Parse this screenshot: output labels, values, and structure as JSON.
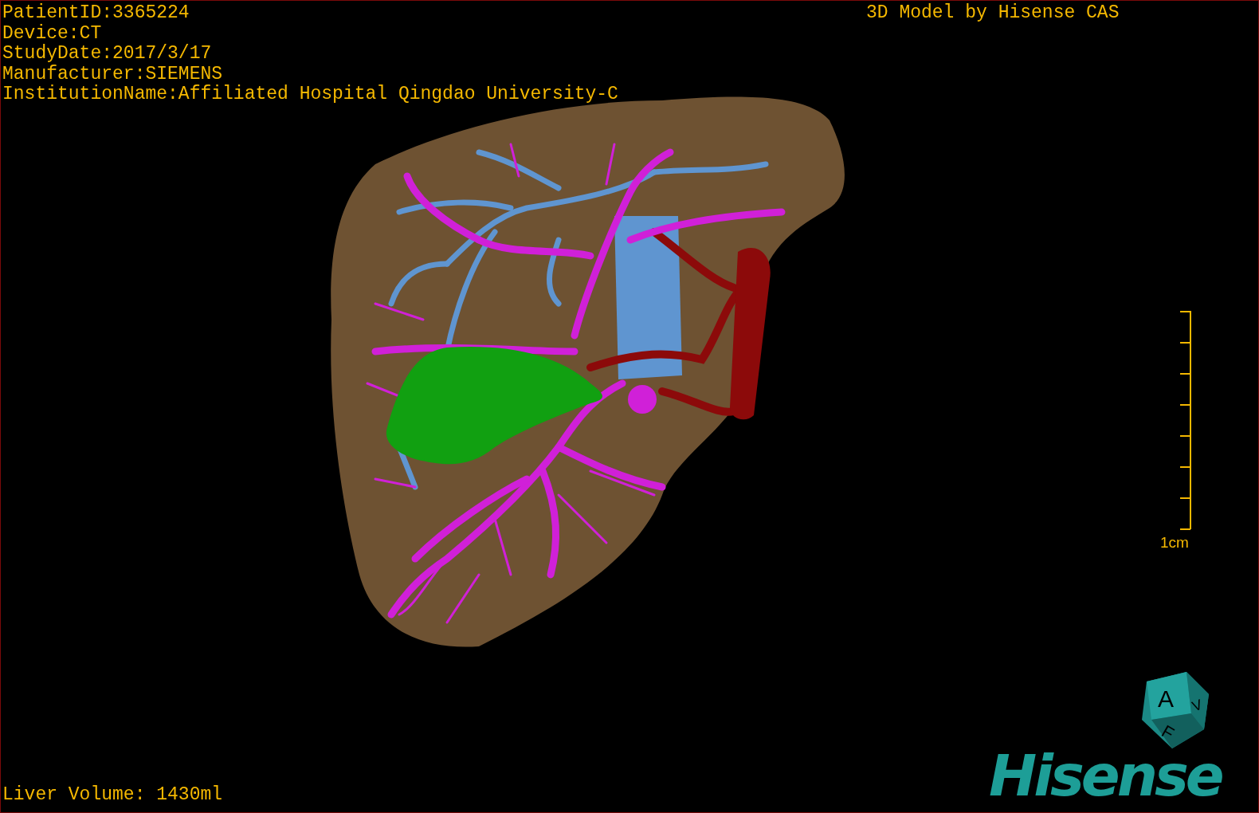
{
  "info_lines": [
    "PatientID:3365224",
    "Device:CT",
    "StudyDate:2017/3/17",
    "Manufacturer:SIEMENS",
    "InstitutionName:Affiliated Hospital Qingdao University-C"
  ],
  "title": "3D Model by Hisense CAS",
  "scale_bar": {
    "label": "1cm"
  },
  "orientation_cube": {
    "faces": [
      "A",
      "V",
      "F"
    ]
  },
  "logo": "Hisense",
  "liver_volume": "Liver Volume: 1430ml"
}
